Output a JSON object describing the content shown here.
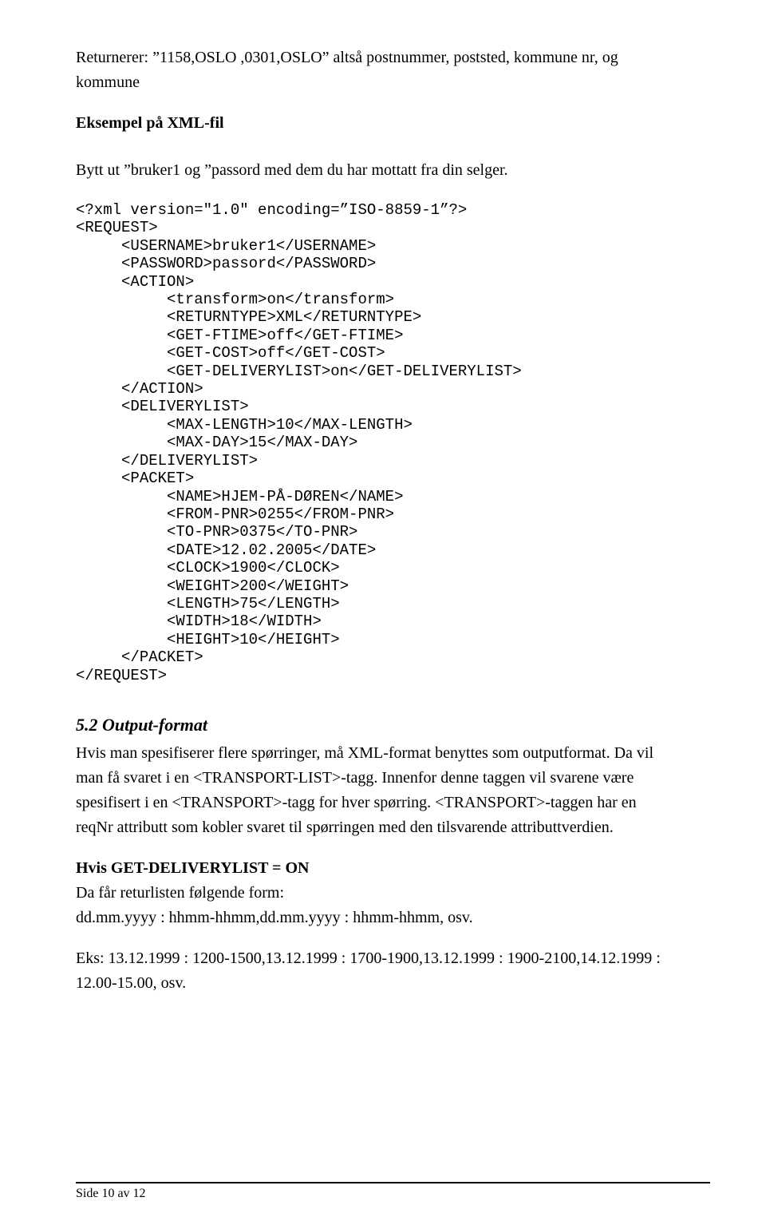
{
  "intro": {
    "line1": "Returnerer:  ”1158,OSLO ,0301,OSLO” altså postnummer, poststed, kommune nr, og",
    "line2": "kommune"
  },
  "heading_example": "Eksempel på XML-fil",
  "instruct_line": "Bytt ut ”bruker1 og ”passord  med dem du har mottatt fra din selger.",
  "code": {
    "l01": "<?xml version=\"1.0\" encoding=”ISO-8859-1”?>",
    "l02": "<REQUEST>",
    "l03": "     <USERNAME>bruker1</USERNAME>",
    "l04": "     <PASSWORD>passord</PASSWORD>",
    "l05": "     <ACTION>",
    "l06": "          <transform>on</transform>",
    "l07": "          <RETURNTYPE>XML</RETURNTYPE>",
    "l08": "          <GET-FTIME>off</GET-FTIME>",
    "l09": "          <GET-COST>off</GET-COST>",
    "l10": "          <GET-DELIVERYLIST>on</GET-DELIVERYLIST>",
    "l11": "     </ACTION>",
    "l12": "     <DELIVERYLIST>",
    "l13": "          <MAX-LENGTH>10</MAX-LENGTH>",
    "l14": "          <MAX-DAY>15</MAX-DAY>",
    "l15": "     </DELIVERYLIST>",
    "l16": "     <PACKET>",
    "l17": "          <NAME>HJEM-PÅ-DØREN</NAME>",
    "l18": "          <FROM-PNR>0255</FROM-PNR>",
    "l19": "          <TO-PNR>0375</TO-PNR>",
    "l20": "          <DATE>12.02.2005</DATE>",
    "l21": "          <CLOCK>1900</CLOCK>",
    "l22": "          <WEIGHT>200</WEIGHT>",
    "l23": "          <LENGTH>75</LENGTH>",
    "l24": "          <WIDTH>18</WIDTH>",
    "l25": "          <HEIGHT>10</HEIGHT>",
    "l26": "     </PACKET>",
    "l27": "</REQUEST>"
  },
  "section_output": "5.2 Output-format",
  "output_para": {
    "l1": "Hvis man spesifiserer flere spørringer, må XML-format benyttes som outputformat. Da vil",
    "l2": "man få svaret i en <TRANSPORT-LIST>-tagg. Innenfor denne taggen vil svarene være",
    "l3": "spesifisert i en <TRANSPORT>-tagg for hver spørring. <TRANSPORT>-taggen har en",
    "l4": "reqNr attributt som kobler svaret til spørringen med den tilsvarende attributtverdien."
  },
  "get_delivery": {
    "title": "Hvis GET-DELIVERYLIST = ON",
    "l1": "Da får returlisten følgende form:",
    "l2": "dd.mm.yyyy : hhmm-hhmm,dd.mm.yyyy : hhmm-hhmm, osv."
  },
  "eks": {
    "l1": "Eks: 13.12.1999 : 1200-1500,13.12.1999 : 1700-1900,13.12.1999 : 1900-2100,14.12.1999 :",
    "l2": "12.00-15.00, osv."
  },
  "footer": "Side 10 av 12"
}
